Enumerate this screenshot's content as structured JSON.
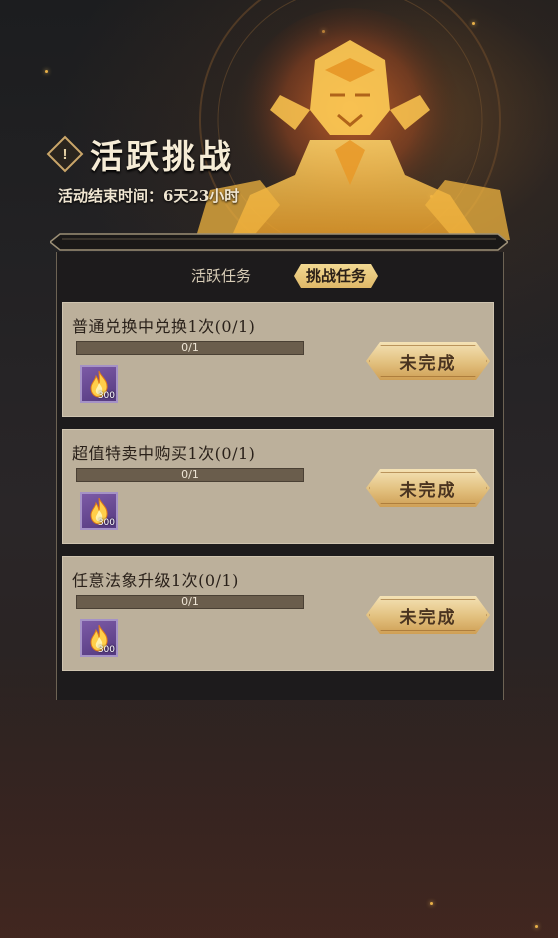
{
  "header": {
    "title": "活跃挑战",
    "title_icon": "!",
    "end_time": "活动结束时间：6天23小时"
  },
  "tabs": [
    {
      "label": "活跃任务",
      "active": false
    },
    {
      "label": "挑战任务",
      "active": true
    }
  ],
  "tasks": [
    {
      "title": "普通兑换中兑换1次(0/1)",
      "progress_text": "0/1",
      "progress": 0,
      "reward_icon": "flame-icon",
      "reward_count": "300",
      "status": "未完成"
    },
    {
      "title": "超值特卖中购买1次(0/1)",
      "progress_text": "0/1",
      "progress": 0,
      "reward_icon": "flame-icon",
      "reward_count": "300",
      "status": "未完成"
    },
    {
      "title": "任意法象升级1次(0/1)",
      "progress_text": "0/1",
      "progress": 0,
      "reward_icon": "flame-icon",
      "reward_count": "300",
      "status": "未完成"
    }
  ],
  "colors": {
    "accent_gold": "#dfb868",
    "card_bg": "#bcb09b",
    "progress_track": "#6a5d4c",
    "reward_bg": "#6a4a94"
  }
}
